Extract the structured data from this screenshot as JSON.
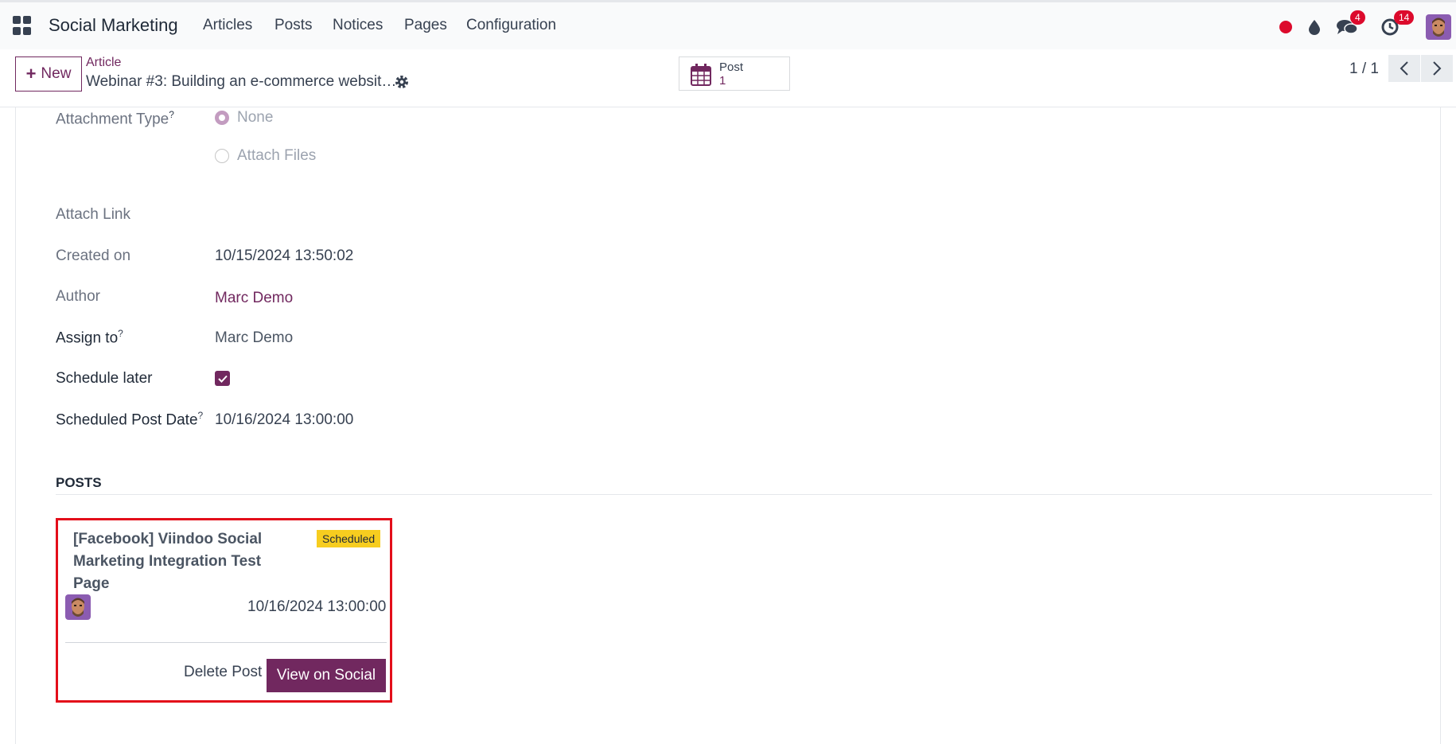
{
  "nav": {
    "app_name": "Social Marketing",
    "menu": [
      "Articles",
      "Posts",
      "Notices",
      "Pages",
      "Configuration"
    ],
    "chat_badge": "4",
    "activity_badge": "14",
    "icons": [
      "apps-icon",
      "record-icon",
      "droplet-icon",
      "chat-icon",
      "clock-icon",
      "user-avatar"
    ]
  },
  "control_panel": {
    "new_label": "New",
    "breadcrumb_parent": "Article",
    "breadcrumb_current": "Webinar #3: Building an e-commerce websit…",
    "smart_button": {
      "label": "Post",
      "value": "1"
    },
    "pager": "1 / 1"
  },
  "form": {
    "attachment_type": {
      "label": "Attachment Type",
      "help": "?",
      "options": [
        "None",
        "Attach Files"
      ],
      "selected": "None"
    },
    "attach_link": {
      "label": "Attach Link",
      "value": ""
    },
    "created_on": {
      "label": "Created on",
      "value": "10/15/2024 13:50:02"
    },
    "author": {
      "label": "Author",
      "value": "Marc Demo"
    },
    "assign_to": {
      "label": "Assign to",
      "help": "?",
      "value": "Marc Demo"
    },
    "schedule_later": {
      "label": "Schedule later",
      "checked": true
    },
    "scheduled_post_date": {
      "label": "Scheduled Post Date",
      "help": "?",
      "value": "10/16/2024 13:00:00"
    }
  },
  "posts": {
    "section_title": "POSTS",
    "card": {
      "title": "[Facebook] Viindoo Social Marketing Integration Test Page",
      "status": "Scheduled",
      "date": "10/16/2024 13:00:00",
      "delete_label": "Delete Post",
      "view_label": "View on Social"
    }
  },
  "colors": {
    "primary": "#71285f",
    "badge": "#dc0a2c",
    "status_scheduled": "#f7cd1f",
    "highlight_border": "#e30e1a"
  }
}
